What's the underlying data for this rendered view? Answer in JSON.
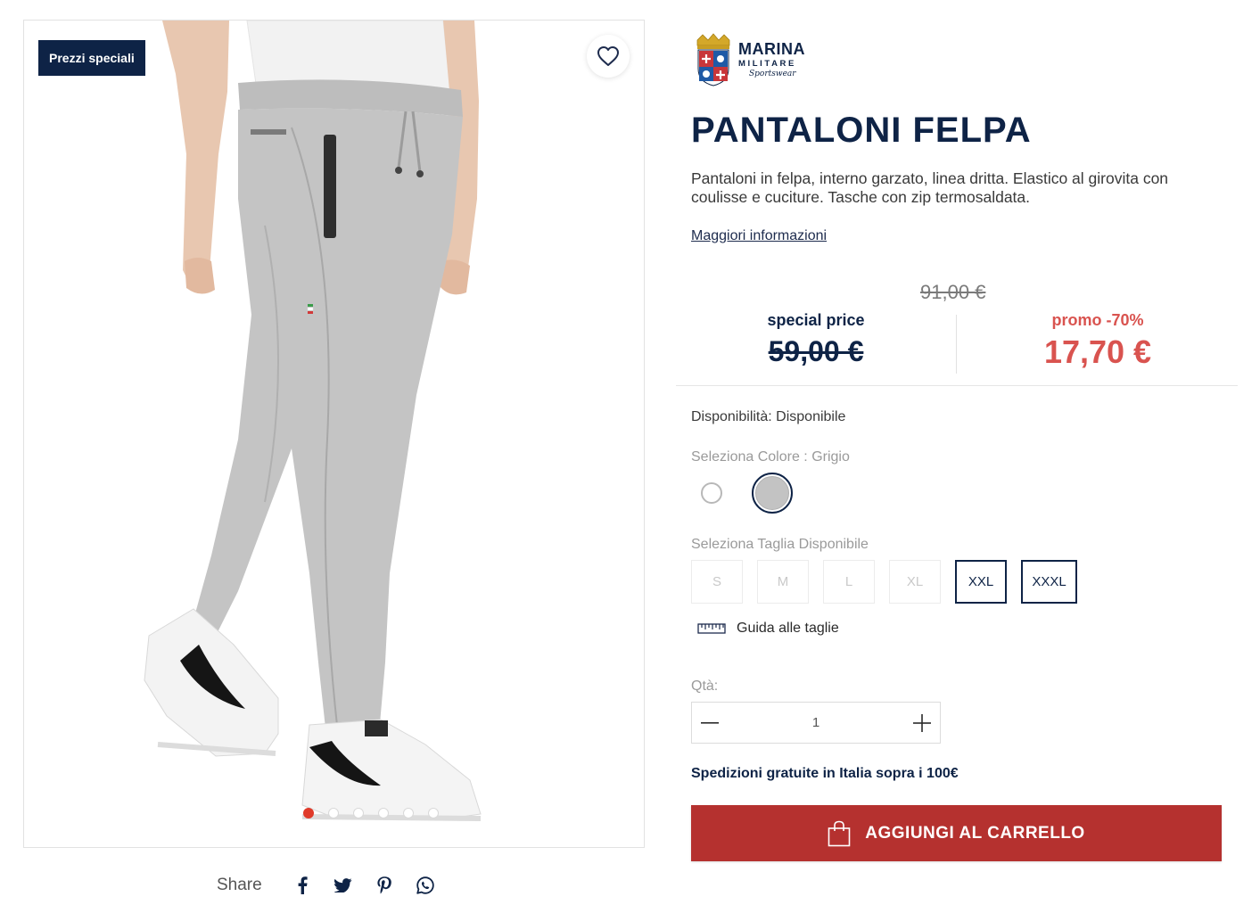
{
  "gallery": {
    "badge": "Prezzi speciali",
    "dots_count": 6,
    "active_dot": 0
  },
  "share": {
    "label": "Share",
    "icons": [
      "facebook-icon",
      "twitter-icon",
      "pinterest-icon",
      "whatsapp-icon"
    ]
  },
  "brand": {
    "line1": "MARINA",
    "line2": "MILITARE",
    "line3": "Sportswear"
  },
  "product": {
    "title": "PANTALONI FELPA",
    "description": "Pantaloni in felpa, interno garzato, linea dritta. Elastico al girovita con coulisse e cuciture. Tasche con zip termosaldata.",
    "more_info": "Maggiori informazioni"
  },
  "price": {
    "original": "91,00 €",
    "special_label": "special price",
    "special_value": "59,00 €",
    "promo_label": "promo -70%",
    "promo_value": "17,70 €"
  },
  "availability": "Disponibilità: Disponibile",
  "color": {
    "label": "Seleziona Colore : Grigio",
    "options": [
      {
        "name": "Bianco",
        "hex": "#ffffff",
        "selected": false
      },
      {
        "name": "Grigio",
        "hex": "#c3c3c3",
        "selected": true
      }
    ]
  },
  "size": {
    "label": "Seleziona Taglia Disponibile",
    "options": [
      {
        "label": "S",
        "available": false
      },
      {
        "label": "M",
        "available": false
      },
      {
        "label": "L",
        "available": false
      },
      {
        "label": "XL",
        "available": false
      },
      {
        "label": "XXL",
        "available": true
      },
      {
        "label": "XXXL",
        "available": true
      }
    ],
    "guide": "Guida alle taglie"
  },
  "quantity": {
    "label": "Qtà:",
    "value": "1"
  },
  "shipping": "Spedizioni gratuite in Italia sopra i 100€",
  "cart_button": "AGGIUNGI AL CARRELLO",
  "colors": {
    "navy": "#0e2346",
    "promo": "#d9534f",
    "cart": "#b5312f",
    "active_dot": "#e03a2a"
  }
}
